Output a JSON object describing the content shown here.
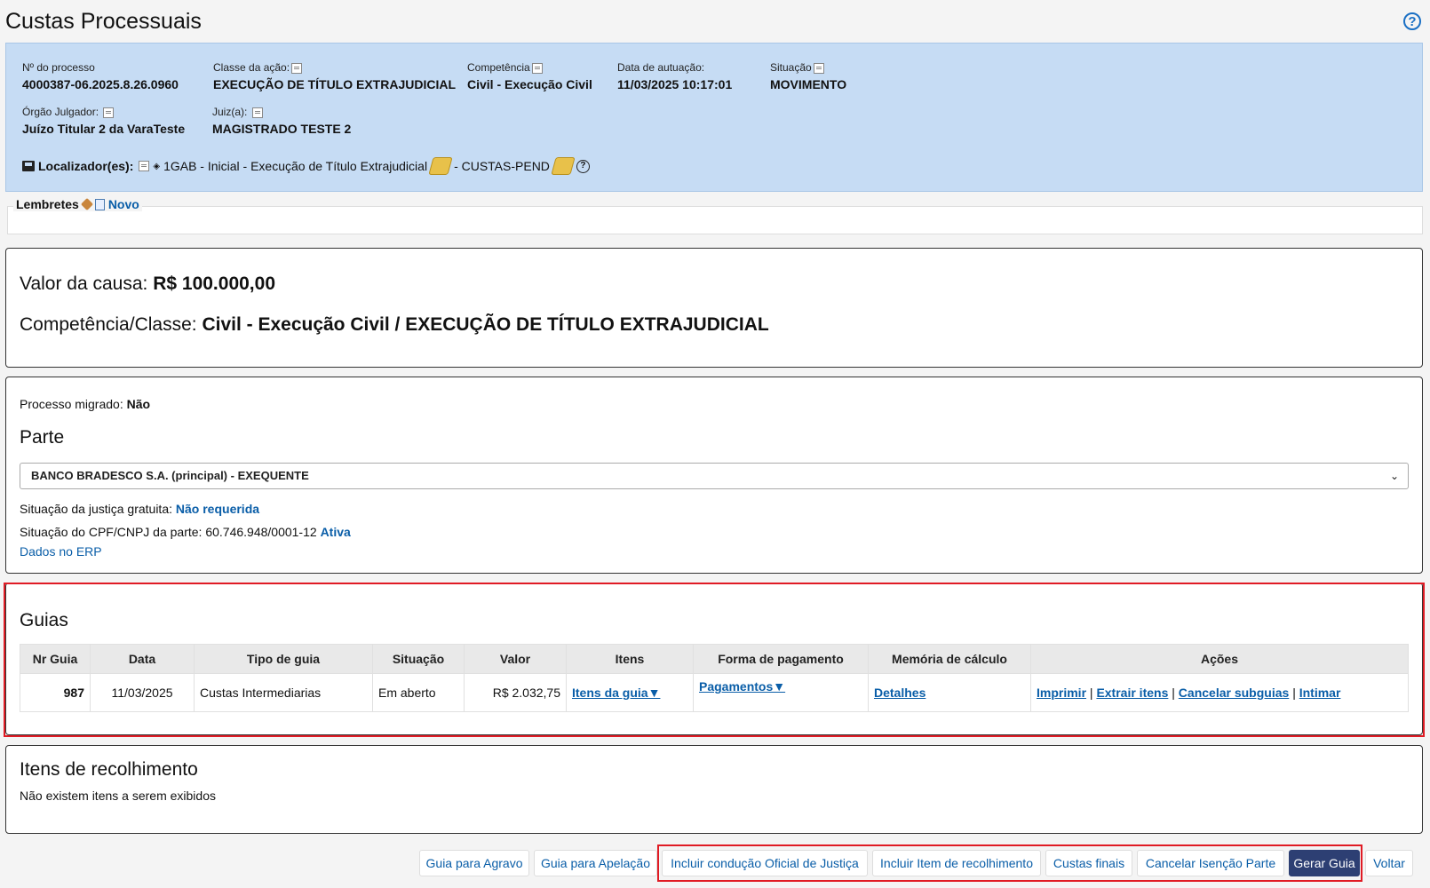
{
  "page": {
    "title": "Custas Processuais"
  },
  "process": {
    "numero_label": "Nº do processo",
    "numero": "4000387-06.2025.8.26.0960",
    "classe_label": "Classe da ação:",
    "classe": "EXECUÇÃO DE TÍTULO EXTRAJUDICIAL",
    "competencia_label": "Competência",
    "competencia": "Civil - Execução Civil",
    "data_label": "Data de autuação:",
    "data": "11/03/2025 10:17:01",
    "situacao_label": "Situação",
    "situacao": "MOVIMENTO",
    "orgao_label": "Órgão Julgador:",
    "orgao": "Juízo Titular 2 da VaraTeste",
    "juiz_label": "Juiz(a):",
    "juiz": "MAGISTRADO TESTE 2",
    "localizador_label": "Localizador(es):",
    "localizador_1": "1GAB - Inicial - Execução de Título Extrajudicial",
    "localizador_2": "- CUSTAS-PEND"
  },
  "lembretes": {
    "label": "Lembretes",
    "novo": "Novo"
  },
  "causa": {
    "valor_label": "Valor da causa:",
    "valor": "R$ 100.000,00",
    "competencia_label": "Competência/Classe:",
    "competencia": "Civil - Execução Civil / EXECUÇÃO DE TÍTULO EXTRAJUDICIAL"
  },
  "parte": {
    "migrado_label": "Processo migrado:",
    "migrado": "Não",
    "title": "Parte",
    "selected": "BANCO BRADESCO S.A. (principal) - EXEQUENTE",
    "gratuita_label": "Situação da justiça gratuita:",
    "gratuita": "Não requerida",
    "cpf_label": "Situação do CPF/CNPJ da parte: 60.746.948/0001-12",
    "cpf_status": "Ativa",
    "erp_link": "Dados no ERP"
  },
  "guias": {
    "title": "Guias",
    "headers": [
      "Nr Guia",
      "Data",
      "Tipo de guia",
      "Situação",
      "Valor",
      "Itens",
      "Forma de pagamento",
      "Memória de cálculo",
      "Ações"
    ],
    "row": {
      "nr": "987",
      "data": "11/03/2025",
      "tipo": "Custas Intermediarias",
      "situacao": "Em aberto",
      "valor": "R$ 2.032,75",
      "itens": "Itens da guia▼",
      "pagamentos": "Pagamentos▼",
      "detalhes": "Detalhes",
      "imprimir": "Imprimir",
      "extrair": "Extrair itens",
      "cancelar": "Cancelar subguias",
      "intimar": "Intimar",
      "sep": "|"
    }
  },
  "itens": {
    "title": "Itens de recolhimento",
    "empty": "Não existem itens a serem exibidos"
  },
  "buttons": {
    "agravo": "Guia para Agravo",
    "apelacao": "Guia para Apelação",
    "conducao": "Incluir condução Oficial de Justiça",
    "item": "Incluir Item de recolhimento",
    "custas_finais": "Custas finais",
    "cancelar_isencao": "Cancelar Isenção Parte",
    "gerar": "Gerar Guia",
    "voltar": "Voltar"
  },
  "colors": {
    "header_bg": "#c6dcf4",
    "link": "#0a5ea8",
    "highlight": "#e01b24",
    "primary_button": "#2d3f73"
  }
}
